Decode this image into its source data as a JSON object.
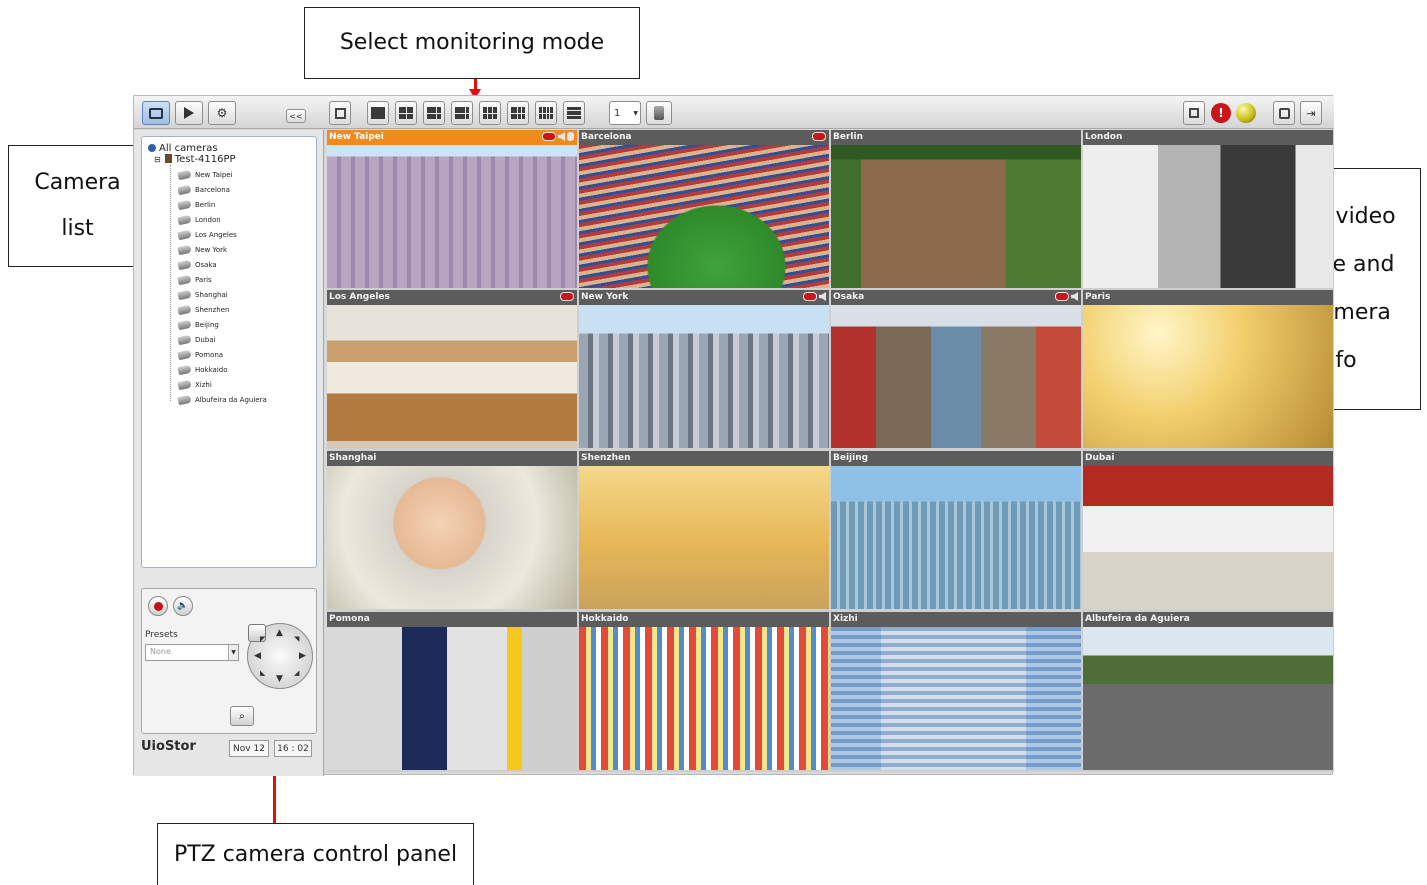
{
  "callouts": {
    "monitoring_mode": "Select monitoring mode",
    "camera_list_line1": "Camera",
    "camera_list_line2": "list",
    "view_video_line1": "View video",
    "view_video_line2": "image and",
    "view_video_line3": "IP camera",
    "view_video_line4": "info",
    "ptz_panel": "PTZ camera control panel"
  },
  "toolbar": {
    "collapse_label": "<<",
    "page_value": "1"
  },
  "tree": {
    "root_label": "All cameras",
    "server_label": "Test-4116PP",
    "cameras": [
      "New Taipei",
      "Barcelona",
      "Berlin",
      "London",
      "Los Angeles",
      "New York",
      "Osaka",
      "Paris",
      "Shanghai",
      "Shenzhen",
      "Beijing",
      "Dubai",
      "Pomona",
      "Hokkaido",
      "Xizhi",
      "Albufeira da Aguiera"
    ]
  },
  "ptz": {
    "presets_label": "Presets",
    "presets_value": "None"
  },
  "footer": {
    "brand": "UioStor",
    "date": "Nov 12",
    "time": "16 : 02"
  },
  "tiles": [
    {
      "name": "New Taipei",
      "active": true,
      "rec": true,
      "audio": true
    },
    {
      "name": "Barcelona",
      "active": false,
      "rec": true,
      "audio": false
    },
    {
      "name": "Berlin",
      "active": false,
      "rec": false,
      "audio": false
    },
    {
      "name": "London",
      "active": false,
      "rec": false,
      "audio": false
    },
    {
      "name": "Los Angeles",
      "active": false,
      "rec": true,
      "audio": false
    },
    {
      "name": "New York",
      "active": false,
      "rec": true,
      "audio": true
    },
    {
      "name": "Osaka",
      "active": false,
      "rec": true,
      "audio": true
    },
    {
      "name": "Paris",
      "active": false,
      "rec": false,
      "audio": false
    },
    {
      "name": "Shanghai",
      "active": false,
      "rec": false,
      "audio": false
    },
    {
      "name": "Shenzhen",
      "active": false,
      "rec": false,
      "audio": false
    },
    {
      "name": "Beijing",
      "active": false,
      "rec": false,
      "audio": false
    },
    {
      "name": "Dubai",
      "active": false,
      "rec": false,
      "audio": false
    },
    {
      "name": "Pomona",
      "active": false,
      "rec": false,
      "audio": false
    },
    {
      "name": "Hokkaido",
      "active": false,
      "rec": false,
      "audio": false
    },
    {
      "name": "Xizhi",
      "active": false,
      "rec": false,
      "audio": false
    },
    {
      "name": "Albufeira da Aguiera",
      "active": false,
      "rec": false,
      "audio": false
    }
  ],
  "colors": {
    "accent_active_tile": "#f08a1d",
    "callout_arrow": "#e01010",
    "alert_red": "#c8161b",
    "status_yellow": "#c9c21a"
  }
}
